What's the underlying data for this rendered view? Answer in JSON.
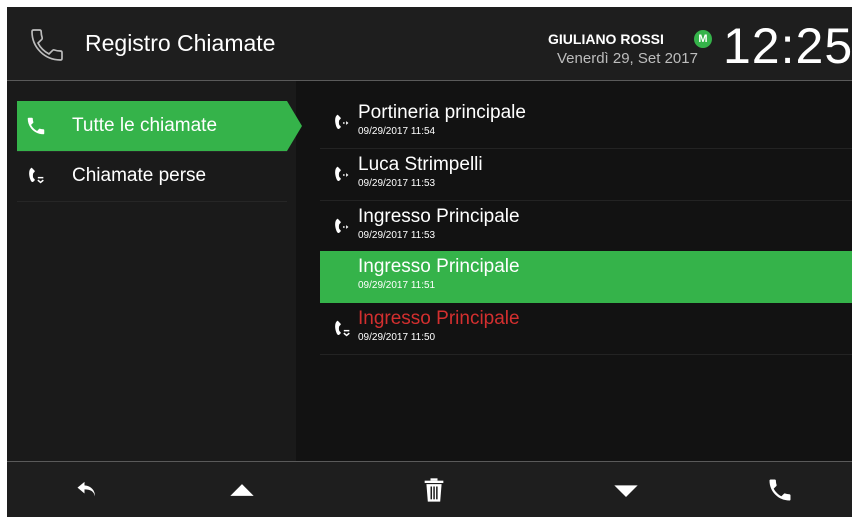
{
  "header": {
    "title": "Registro Chiamate",
    "user_name": "GIULIANO ROSSI",
    "user_badge": "M",
    "date": "Venerdì 29, Set 2017",
    "clock": "12:25"
  },
  "sidebar": {
    "items": [
      {
        "label": "Tutte le chiamate",
        "icon": "phone-icon",
        "active": true
      },
      {
        "label": "Chiamate perse",
        "icon": "missed-call-icon",
        "active": false
      }
    ]
  },
  "calls": [
    {
      "name": "Portineria principale",
      "time": "09/29/2017 11:54",
      "type": "outgoing"
    },
    {
      "name": "Luca Strimpelli",
      "time": "09/29/2017 11:53",
      "type": "outgoing"
    },
    {
      "name": "Ingresso Principale",
      "time": "09/29/2017 11:53",
      "type": "outgoing"
    },
    {
      "name": "Ingresso Principale",
      "time": "09/29/2017 11:51",
      "type": "selected"
    },
    {
      "name": "Ingresso Principale",
      "time": "09/29/2017 11:50",
      "type": "missed"
    }
  ],
  "footer": {
    "buttons": [
      "back-icon",
      "up-arrow-icon",
      "trash-icon",
      "down-arrow-icon",
      "call-icon"
    ]
  },
  "colors": {
    "accent": "#35b34a",
    "missed": "#d32f2f",
    "background": "#121212"
  }
}
